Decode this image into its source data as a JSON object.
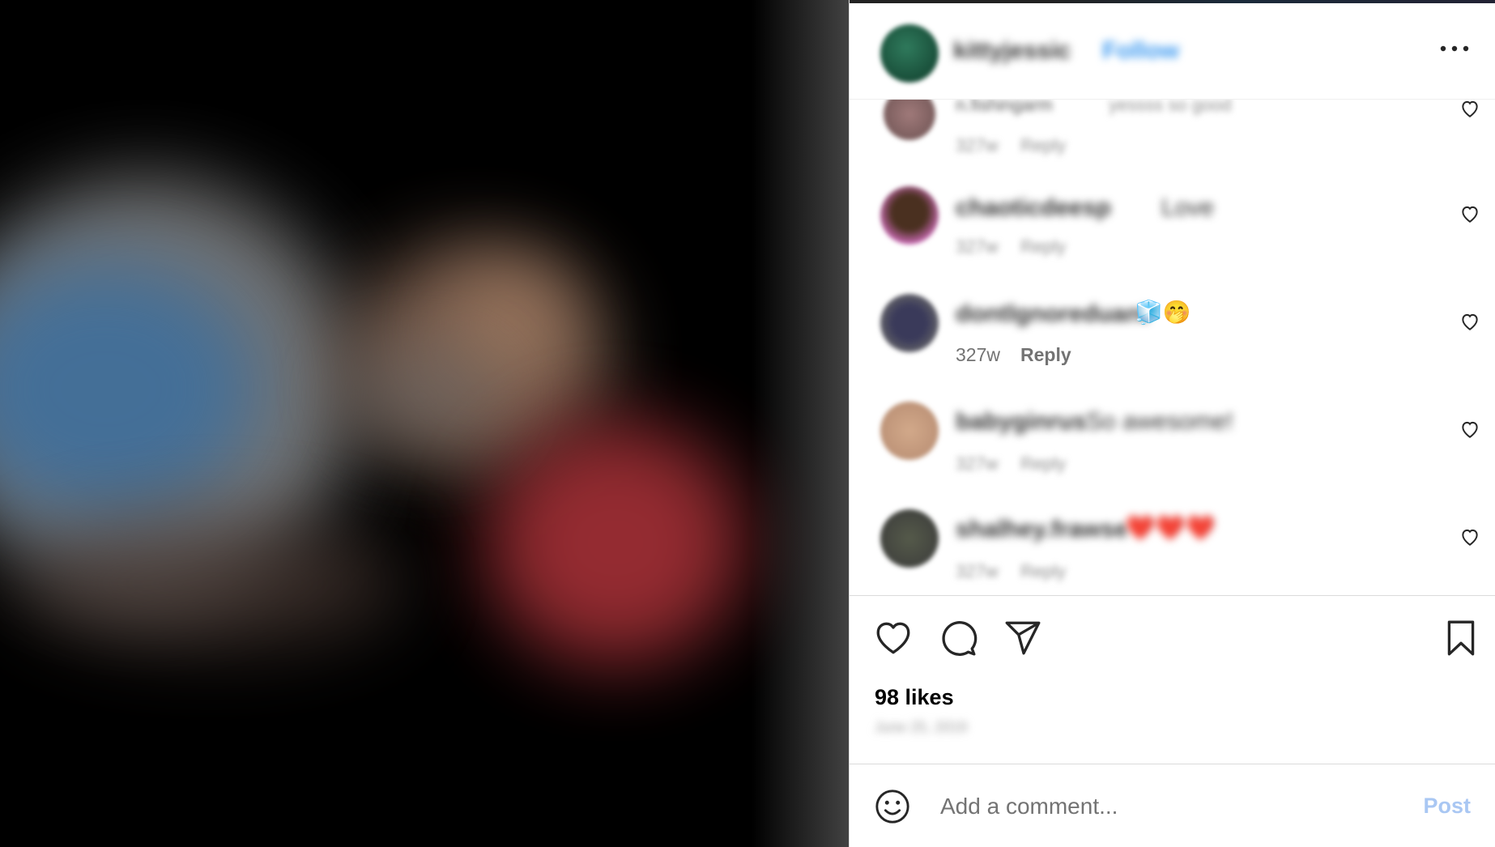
{
  "post": {
    "header": {
      "username": "kittyjessic",
      "follow_label": "Follow",
      "more_icon": "more-horizontal-icon"
    },
    "comments": [
      {
        "username": "n.fishingarm",
        "text": "yessss so good",
        "time": "327w",
        "reply_label": "Reply"
      },
      {
        "username": "chaoticdeesp",
        "text": "Love",
        "time": "327w",
        "reply_label": "Reply"
      },
      {
        "username": "dontlgnoreduant",
        "text": "🧊🤭",
        "time": "327w",
        "reply_label": "Reply"
      },
      {
        "username": "babyginrus",
        "text": "So awesome!",
        "time": "327w",
        "reply_label": "Reply"
      },
      {
        "username": "shalhey.frawse",
        "text": "❤️❤️❤️",
        "time": "327w",
        "reply_label": "Reply"
      }
    ],
    "likes_text": "98 likes",
    "date_text": "June 25, 2019",
    "comment_bar": {
      "placeholder": "Add a comment...",
      "post_label": "Post"
    },
    "colors": {
      "post_button": "#a9c7f3",
      "meta_text": "#737373",
      "divider": "#dbdbdb"
    }
  }
}
